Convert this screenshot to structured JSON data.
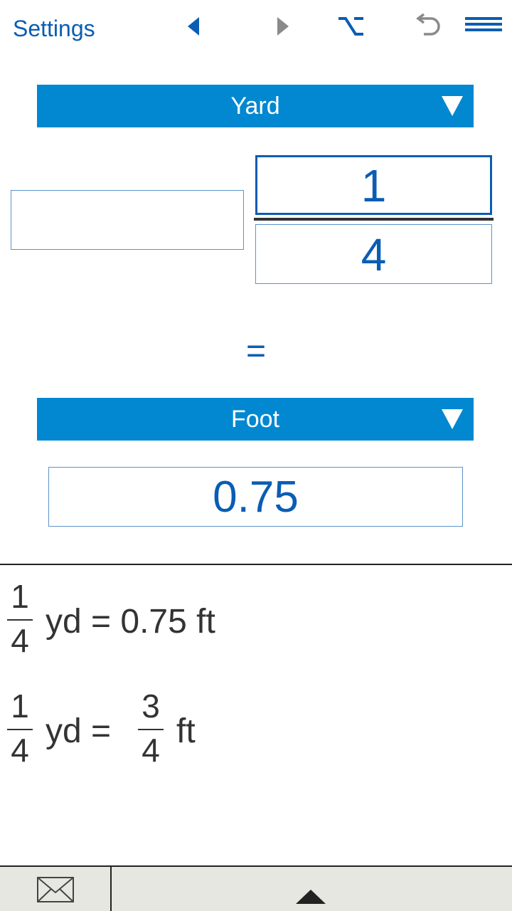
{
  "toolbar": {
    "settings_label": "Settings",
    "icons": [
      "triangle-left-icon",
      "triangle-right-icon",
      "option-key-icon",
      "undo-icon",
      "menu-icon"
    ]
  },
  "from_unit": {
    "label": "Yard"
  },
  "input": {
    "whole": "",
    "numerator": "1",
    "denominator": "4"
  },
  "equals": "=",
  "to_unit": {
    "label": "Foot"
  },
  "result": {
    "value": "0.75"
  },
  "history": [
    {
      "numerator": "1",
      "denominator": "4",
      "text": "yd = 0.75 ft"
    },
    {
      "numerator": "1",
      "denominator": "4",
      "mid_text": "yd =",
      "result_numerator": "3",
      "result_denominator": "4",
      "unit": "ft"
    }
  ],
  "colors": {
    "accent": "#0288d1",
    "link": "#0a5db3",
    "bottom_bar": "#e7e7e2"
  }
}
